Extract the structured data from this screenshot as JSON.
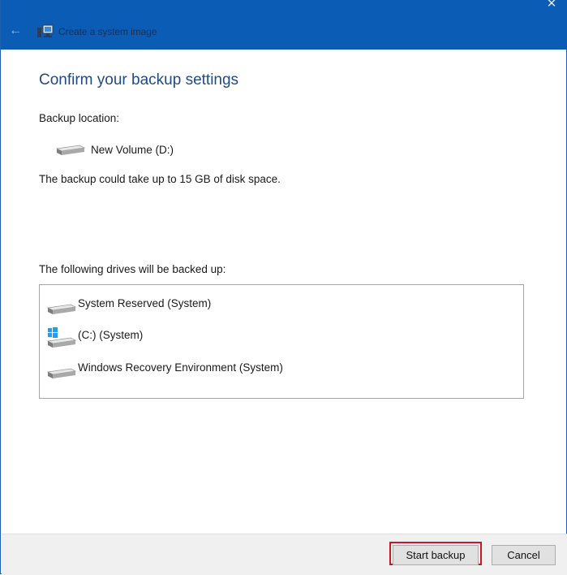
{
  "window": {
    "title": "Create a system image",
    "close_glyph": "✕",
    "back_glyph": "←",
    "colors": {
      "titlebar": "#0a5cb4",
      "heading": "#1f4b84",
      "highlight": "#c8192c"
    }
  },
  "content": {
    "heading": "Confirm your backup settings",
    "backup_location_label": "Backup location:",
    "backup_location_value": "New Volume (D:)",
    "space_notice": "The backup could take up to 15 GB of disk space.",
    "drives_label": "The following drives will be backed up:",
    "drives": [
      {
        "name": "System Reserved (System)",
        "icon": "hard-drive-icon"
      },
      {
        "name": "(C:) (System)",
        "icon": "windows-drive-icon"
      },
      {
        "name": "Windows Recovery Environment (System)",
        "icon": "hard-drive-icon"
      }
    ]
  },
  "footer": {
    "start_backup_label": "Start backup",
    "cancel_label": "Cancel"
  }
}
